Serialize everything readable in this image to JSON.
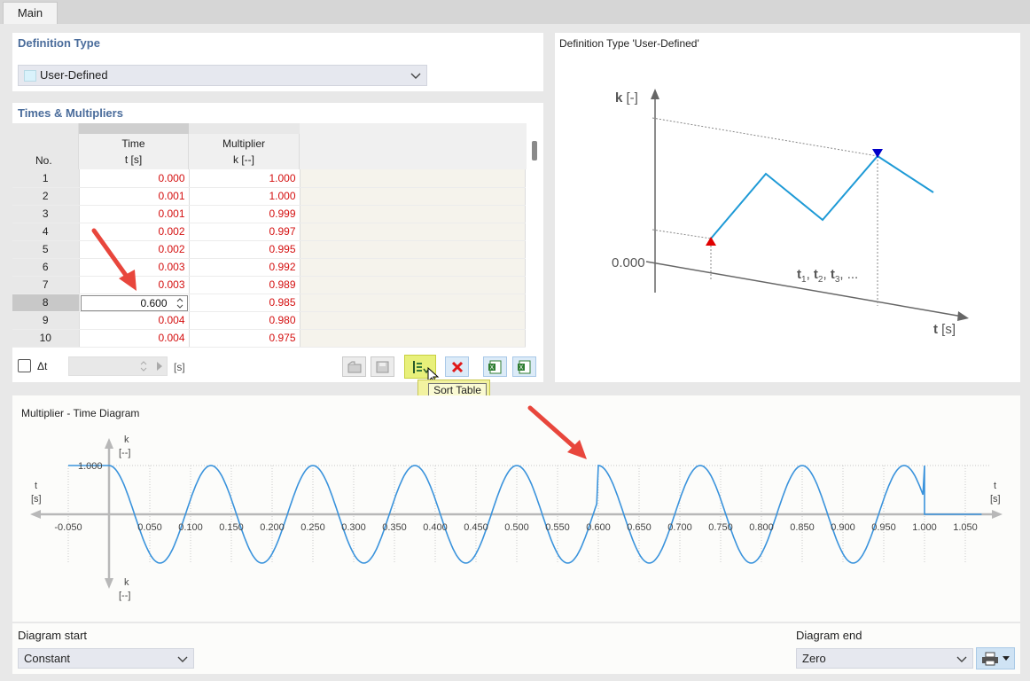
{
  "tabs": {
    "main": "Main"
  },
  "definition": {
    "title": "Definition Type",
    "value": "User-Defined"
  },
  "table": {
    "title": "Times & Multipliers",
    "col_no": "No.",
    "col_time": "Time",
    "col_time_unit": "t [s]",
    "col_mult": "Multiplier",
    "col_mult_unit": "k [--]",
    "rows": [
      {
        "no": "1",
        "t": "0.000",
        "k": "1.000"
      },
      {
        "no": "2",
        "t": "0.001",
        "k": "1.000"
      },
      {
        "no": "3",
        "t": "0.001",
        "k": "0.999"
      },
      {
        "no": "4",
        "t": "0.002",
        "k": "0.997"
      },
      {
        "no": "5",
        "t": "0.002",
        "k": "0.995"
      },
      {
        "no": "6",
        "t": "0.003",
        "k": "0.992"
      },
      {
        "no": "7",
        "t": "0.003",
        "k": "0.989"
      },
      {
        "no": "8",
        "t": "0.600",
        "k": "0.985"
      },
      {
        "no": "9",
        "t": "0.004",
        "k": "0.980"
      },
      {
        "no": "10",
        "t": "0.004",
        "k": "0.975"
      }
    ],
    "delta_label": "Δt",
    "delta_unit": "[s]",
    "tooltip": "Sort Table"
  },
  "preview": {
    "title": "Definition Type 'User-Defined'",
    "k_label": "k",
    "k_unit": "[-]",
    "zero": "0.000",
    "t_label": "t",
    "t_unit": "[s]",
    "t_series": "t",
    "t_sub1": "1",
    "t_sub2": "2",
    "t_sub3": "3",
    "t_ellipsis": "..."
  },
  "diagram": {
    "title": "Multiplier - Time Diagram",
    "k": "k",
    "k_unit": "[--]",
    "t": "t",
    "t_unit": "[s]",
    "one": "1.000",
    "ticks": [
      "-0.050",
      "0.050",
      "0.100",
      "0.150",
      "0.200",
      "0.250",
      "0.300",
      "0.350",
      "0.400",
      "0.450",
      "0.500",
      "0.550",
      "0.600",
      "0.650",
      "0.700",
      "0.750",
      "0.800",
      "0.850",
      "0.900",
      "0.950",
      "1.000",
      "1.050"
    ]
  },
  "footer": {
    "start_label": "Diagram start",
    "start_value": "Constant",
    "end_label": "Diagram end",
    "end_value": "Zero"
  },
  "colors": {
    "accent": "#4a6c9b",
    "red": "#d41010",
    "curve": "#3a8fdc"
  }
}
